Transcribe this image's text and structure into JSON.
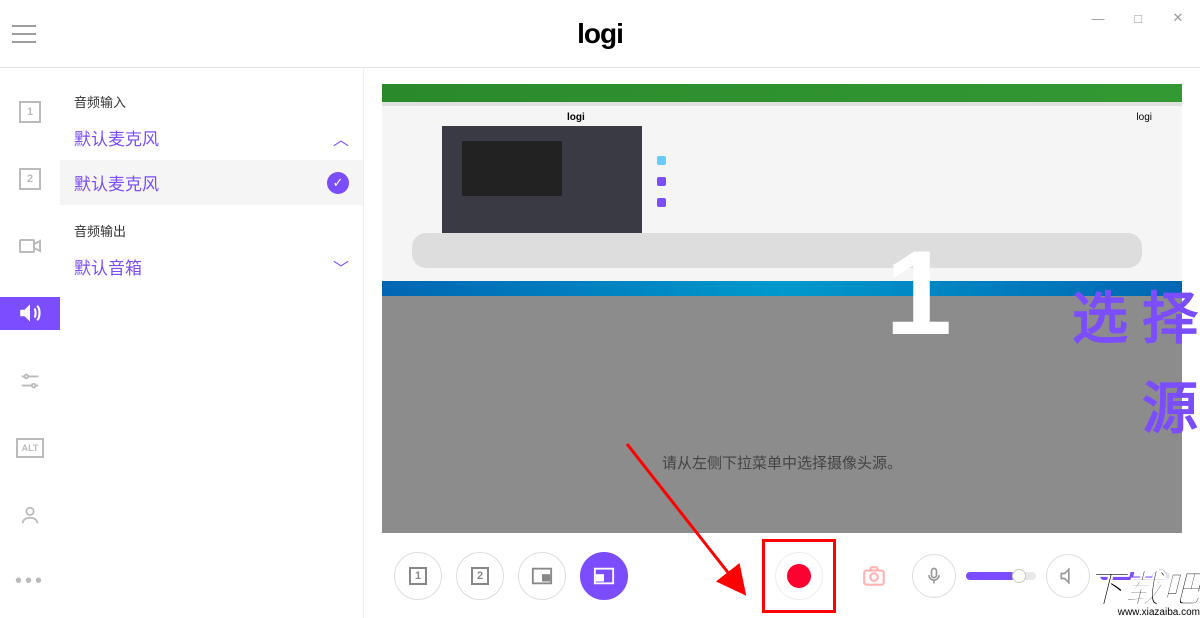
{
  "app": {
    "name": "logi"
  },
  "window": {
    "minimize": "—",
    "maximize": "□",
    "close": "✕"
  },
  "leftrail": {
    "source1": "1",
    "source2": "2"
  },
  "sidebar": {
    "audio_input_label": "音频输入",
    "audio_input_value": "默认麦克风",
    "selected_mic": "默认麦克风",
    "audio_output_label": "音频输出",
    "audio_output_value": "默认音箱"
  },
  "preview": {
    "big_text_1": "选择",
    "big_text_2": "源",
    "overlay_number": "1",
    "instruction": "请从左侧下拉菜单中选择摄像头源。",
    "inner_logo": "logi",
    "inner_panel": "logi"
  },
  "bottombar": {
    "btn1": "1",
    "btn2": "2",
    "mic_level": 70,
    "speaker_level": 80
  },
  "watermark": {
    "text": "下载吧",
    "url": "www.xiazaiba.com"
  }
}
